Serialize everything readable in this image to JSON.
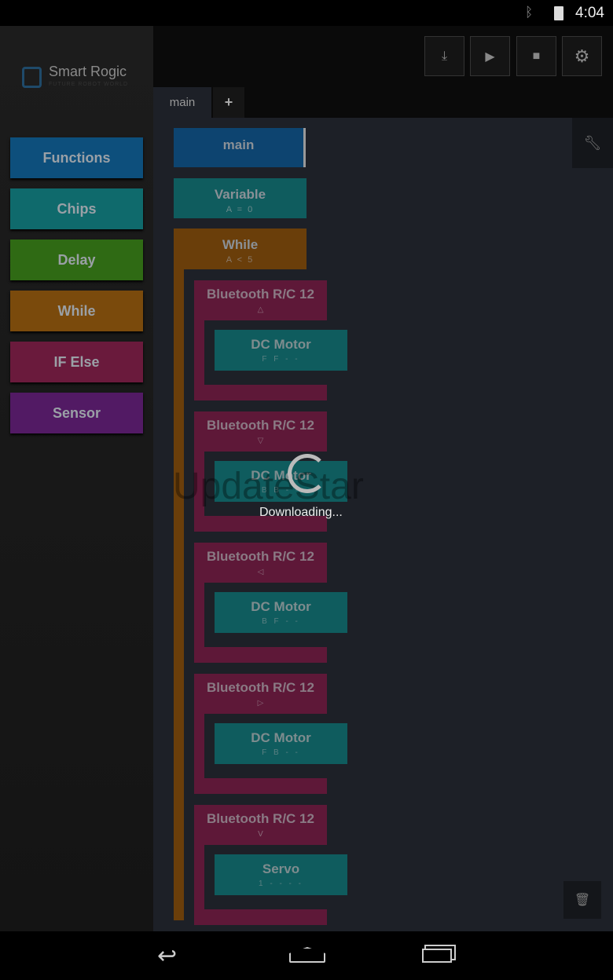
{
  "status_bar": {
    "time": "4:04",
    "icons": [
      "bluetooth-icon",
      "battery-icon"
    ]
  },
  "app": {
    "logo_title": "Smart Rogic",
    "logo_subtitle": "FUTURE ROBOT WORLD"
  },
  "palette": [
    {
      "label": "Functions",
      "color": "#0d4f7c"
    },
    {
      "label": "Chips",
      "color": "#0f6a6c"
    },
    {
      "label": "Delay",
      "color": "#2f6a14"
    },
    {
      "label": "While",
      "color": "#7a4a0c"
    },
    {
      "label": "IF Else",
      "color": "#6a1a3c"
    },
    {
      "label": "Sensor",
      "color": "#521a64"
    }
  ],
  "toolbar": [
    "download-icon",
    "play-icon",
    "stop-icon",
    "gear-icon"
  ],
  "tabs": [
    {
      "label": "main",
      "active": true
    },
    {
      "label": "+"
    }
  ],
  "program": {
    "main": {
      "title": "main"
    },
    "variable": {
      "title": "Variable",
      "sub": "A = 0"
    },
    "while": {
      "title": "While",
      "sub": "A < 5"
    },
    "blocks": [
      {
        "title": "Bluetooth R/C 12",
        "sub": "△",
        "chip": "DC Motor",
        "chip_sub": "F F - -"
      },
      {
        "title": "Bluetooth R/C 12",
        "sub": "▽",
        "chip": "DC Motor",
        "chip_sub": "B B - -"
      },
      {
        "title": "Bluetooth R/C 12",
        "sub": "◁",
        "chip": "DC Motor",
        "chip_sub": "B F - -"
      },
      {
        "title": "Bluetooth R/C 12",
        "sub": "▷",
        "chip": "DC Motor",
        "chip_sub": "F B - -"
      },
      {
        "title": "Bluetooth R/C 12",
        "sub": "V",
        "chip": "Servo",
        "chip_sub": "1 - - - -"
      }
    ]
  },
  "overlay": {
    "message": "Downloading...",
    "watermark": "UpdateStar"
  }
}
